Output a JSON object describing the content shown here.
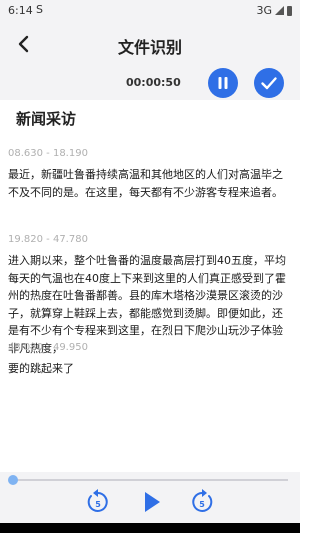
{
  "status": {
    "time": "6:14",
    "sync_icon": "S",
    "network": "3G"
  },
  "header": {
    "title": "文件识别",
    "timer": "00:00:50"
  },
  "document": {
    "title": "新闻采访",
    "segments": [
      {
        "time": "08.630 - 18.190",
        "text": "最近，新疆吐鲁番持续高温和其他地区的人们对高温毕之不及不同的是。在这里，每天都有不少游客专程来追者。"
      },
      {
        "time": "19.820 - 47.780",
        "text": "进入期以来，整个吐鲁番的温度最高层打到40五度，平均每天的气温也在40度上下来到这里的人们真正感受到了霍州的热度在吐鲁番鄯善。县的库木塔格沙漠景区滚烫的沙子，就算穿上鞋踩上去，都能感觉到烫脚。即便如此，还是有不少有个专程来到这里，在烈日下爬沙山玩沙子体验非凡热度，"
      },
      {
        "time": "48.080 - 49.950",
        "text": "要的跳起来了"
      }
    ]
  },
  "player": {
    "progress": 0.0,
    "rewind_seconds": "5",
    "forward_seconds": "5"
  },
  "colors": {
    "accent": "#2f6fe6",
    "background": "#f3f3f5"
  },
  "icons": [
    "back-arrow-icon",
    "pause-icon",
    "check-icon",
    "rewind-5-icon",
    "play-icon",
    "forward-5-icon",
    "signal-icon",
    "battery-icon"
  ]
}
